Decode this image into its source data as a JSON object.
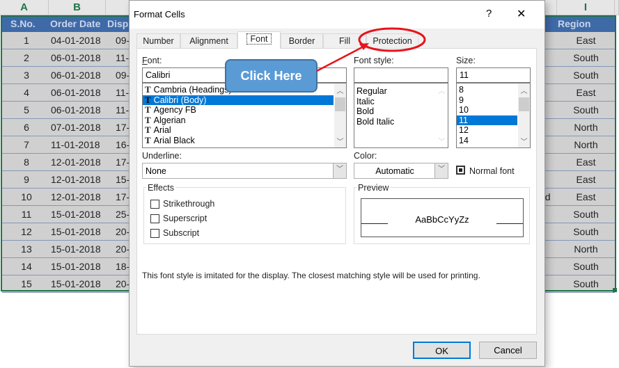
{
  "sheet": {
    "column_letters": [
      "A",
      "B",
      "I"
    ],
    "headers": [
      "S.No.",
      "Order Date",
      "Disp",
      "Region"
    ],
    "rows": [
      {
        "sno": "1",
        "order_date": "04-01-2018",
        "dispatch": "09-",
        "region": "East"
      },
      {
        "sno": "2",
        "order_date": "06-01-2018",
        "dispatch": "11-",
        "region": "South"
      },
      {
        "sno": "3",
        "order_date": "06-01-2018",
        "dispatch": "09-",
        "region": "South"
      },
      {
        "sno": "4",
        "order_date": "06-01-2018",
        "dispatch": "11-",
        "region": "East"
      },
      {
        "sno": "5",
        "order_date": "06-01-2018",
        "dispatch": "11-",
        "region": "South"
      },
      {
        "sno": "6",
        "order_date": "07-01-2018",
        "dispatch": "17-",
        "region": "North"
      },
      {
        "sno": "7",
        "order_date": "11-01-2018",
        "dispatch": "16-",
        "region": "North"
      },
      {
        "sno": "8",
        "order_date": "12-01-2018",
        "dispatch": "17-",
        "region": "East"
      },
      {
        "sno": "9",
        "order_date": "12-01-2018",
        "dispatch": "15-",
        "region": "East"
      },
      {
        "sno": "10",
        "order_date": "12-01-2018",
        "dispatch": "17-",
        "region": "East",
        "extra": "nd"
      },
      {
        "sno": "11",
        "order_date": "15-01-2018",
        "dispatch": "25-",
        "region": "South"
      },
      {
        "sno": "12",
        "order_date": "15-01-2018",
        "dispatch": "20-",
        "region": "South"
      },
      {
        "sno": "13",
        "order_date": "15-01-2018",
        "dispatch": "20-",
        "region": "North"
      },
      {
        "sno": "14",
        "order_date": "15-01-2018",
        "dispatch": "18-",
        "region": "South"
      },
      {
        "sno": "15",
        "order_date": "15-01-2018",
        "dispatch": "20-",
        "region": "South"
      }
    ]
  },
  "dialog": {
    "title": "Format Cells",
    "help": "?",
    "close": "✕",
    "tabs": [
      "Number",
      "Alignment",
      "Font",
      "Border",
      "Fill",
      "Protection"
    ],
    "active_tab": "Font",
    "font": {
      "label": "Font:",
      "value": "Calibri",
      "items": [
        "Cambria (Headings)",
        "Calibri (Body)",
        "Agency FB",
        "Algerian",
        "Arial",
        "Arial Black"
      ],
      "selected": "Calibri (Body)"
    },
    "font_style": {
      "label": "Font style:",
      "value": "",
      "items": [
        "Regular",
        "Italic",
        "Bold",
        "Bold Italic"
      ]
    },
    "size": {
      "label": "Size:",
      "value": "11",
      "items": [
        "8",
        "9",
        "10",
        "11",
        "12",
        "14"
      ],
      "selected": "11"
    },
    "underline": {
      "label": "Underline:",
      "value": "None"
    },
    "color": {
      "label": "Color:",
      "value": "Automatic"
    },
    "normal_font": "Normal font",
    "effects": {
      "label": "Effects",
      "items": [
        {
          "label": "Strikethrough",
          "checked": false
        },
        {
          "label": "Superscript",
          "checked": false
        },
        {
          "label": "Subscript",
          "checked": false
        }
      ]
    },
    "preview": {
      "label": "Preview",
      "sample": "AaBbCcYyZz"
    },
    "note": "This font style is imitated for the display.  The closest matching style will be used for printing.",
    "ok": "OK",
    "cancel": "Cancel"
  },
  "annotation": {
    "callout": "Click Here",
    "callout_color": "#5b9bd5",
    "highlight_color": "#e8131b"
  }
}
